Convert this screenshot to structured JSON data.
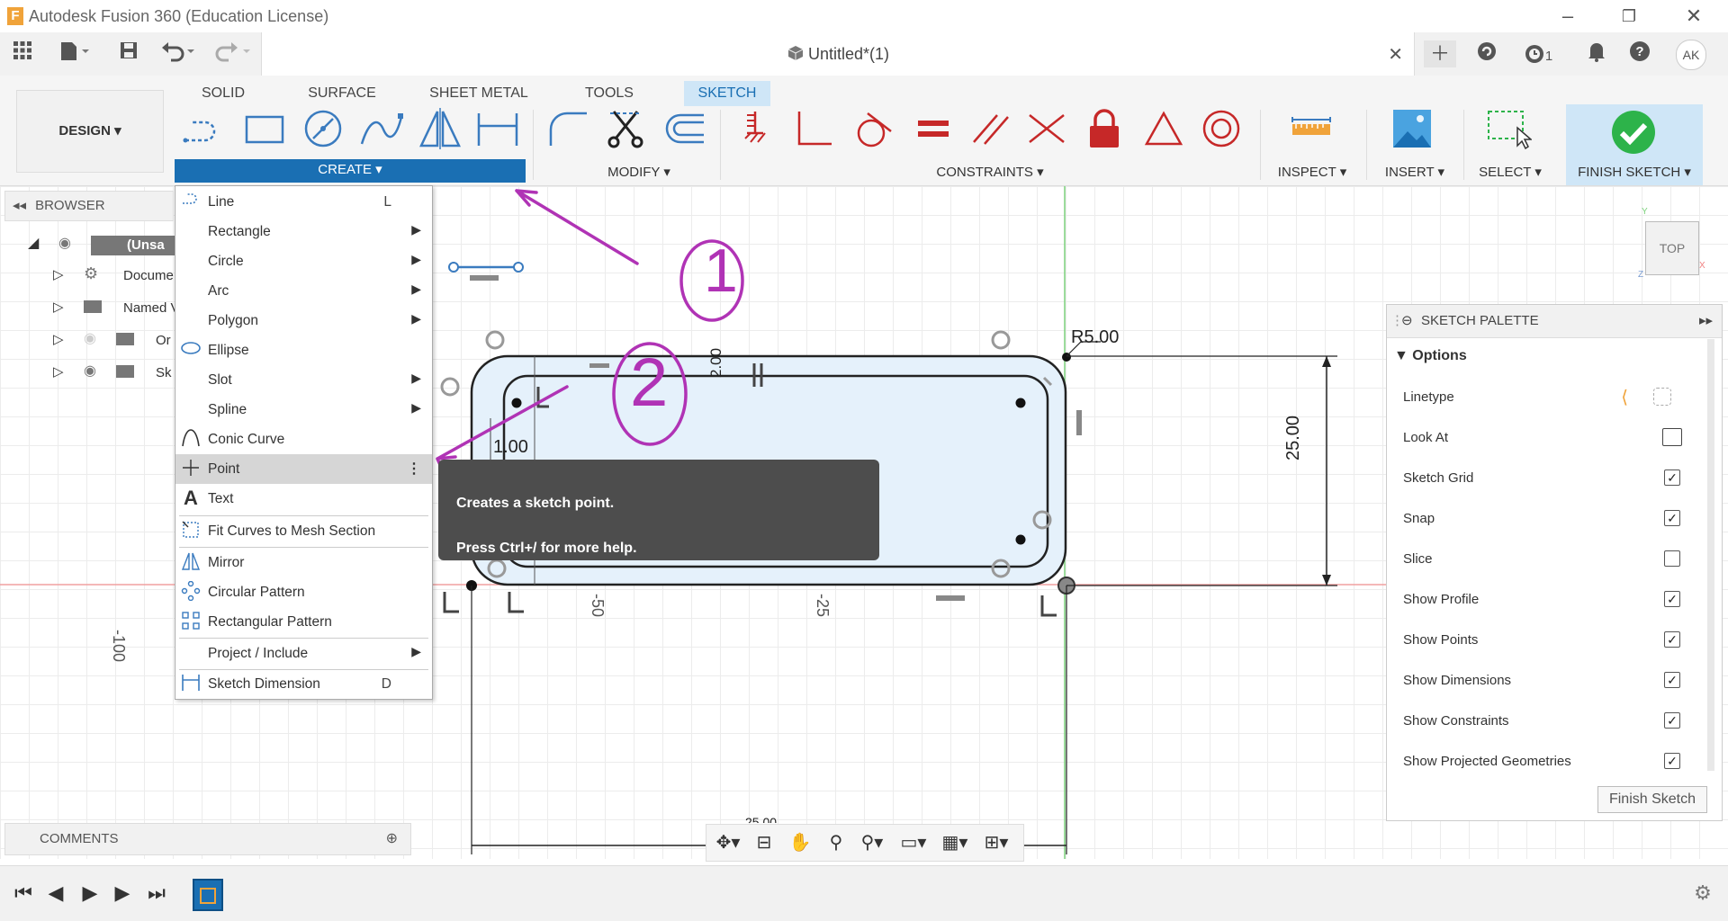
{
  "window": {
    "title": "Autodesk Fusion 360 (Education License)",
    "app_icon": "F",
    "controls": {
      "minimize": "–",
      "restore": "❐",
      "close": "✕"
    }
  },
  "quick_access": {
    "document_title": "Untitled*(1)",
    "job_count": "1",
    "user_initials": "AK"
  },
  "ribbon": {
    "tabs": [
      "SOLID",
      "SURFACE",
      "SHEET METAL",
      "TOOLS",
      "SKETCH"
    ],
    "active_tab": "SKETCH",
    "workspace": "DESIGN ▾",
    "groups": {
      "create": "CREATE ▾",
      "modify": "MODIFY ▾",
      "constraints": "CONSTRAINTS ▾",
      "inspect": "INSPECT ▾",
      "insert": "INSERT ▾",
      "select": "SELECT ▾",
      "finish": "FINISH SKETCH ▾"
    }
  },
  "browser": {
    "title": "BROWSER",
    "items": [
      {
        "label": "(Unsa",
        "icon": "component-icon"
      },
      {
        "label": "Docume",
        "icon": "gear-icon"
      },
      {
        "label": "Named V",
        "icon": "folder-icon"
      },
      {
        "label": "Or",
        "icon": "folder-icon"
      },
      {
        "label": "Sk",
        "icon": "folder-icon"
      }
    ]
  },
  "create_menu": {
    "items": [
      {
        "label": "Line",
        "shortcut": "L",
        "icon": "line-icon"
      },
      {
        "label": "Rectangle",
        "submenu": true
      },
      {
        "label": "Circle",
        "submenu": true
      },
      {
        "label": "Arc",
        "submenu": true
      },
      {
        "label": "Polygon",
        "submenu": true
      },
      {
        "label": "Ellipse",
        "icon": "ellipse-icon"
      },
      {
        "label": "Slot",
        "submenu": true
      },
      {
        "label": "Spline",
        "submenu": true
      },
      {
        "label": "Conic Curve",
        "icon": "conic-curve-icon"
      },
      {
        "label": "Point",
        "icon": "point-icon",
        "highlighted": true
      },
      {
        "label": "Text",
        "icon": "text-icon"
      },
      {
        "label": "Fit Curves to Mesh Section",
        "icon": "fit-curves-icon"
      },
      {
        "label": "Mirror",
        "icon": "mirror-icon"
      },
      {
        "label": "Circular Pattern",
        "icon": "circular-pattern-icon"
      },
      {
        "label": "Rectangular Pattern",
        "icon": "rectangular-pattern-icon"
      },
      {
        "label": "Project / Include",
        "submenu": true
      },
      {
        "label": "Sketch Dimension",
        "shortcut": "D",
        "icon": "sketch-dimension-icon"
      }
    ]
  },
  "tooltip": {
    "line1": "Creates a sketch point.",
    "line2": "Press Ctrl+/ for more help."
  },
  "annotations": {
    "one": "1",
    "two": "2"
  },
  "canvas": {
    "dimensions": {
      "radius": "R5.00",
      "height": "25.00",
      "top_small": "2.00",
      "left_small": "1.00",
      "bottom_partial": "25.00"
    },
    "axis_labels": {
      "minus100": "-100",
      "minus50": "-50",
      "minus25": "-25"
    }
  },
  "viewcube": {
    "face": "TOP",
    "x": "X",
    "y": "Y",
    "z": "Z"
  },
  "sketch_palette": {
    "title": "SKETCH PALETTE",
    "section": "Options",
    "rows": [
      {
        "label": "Linetype",
        "type": "icons"
      },
      {
        "label": "Look At",
        "type": "icon"
      },
      {
        "label": "Sketch Grid",
        "checked": true
      },
      {
        "label": "Snap",
        "checked": true
      },
      {
        "label": "Slice",
        "checked": false
      },
      {
        "label": "Show Profile",
        "checked": true
      },
      {
        "label": "Show Points",
        "checked": true
      },
      {
        "label": "Show Dimensions",
        "checked": true
      },
      {
        "label": "Show Constraints",
        "checked": true
      },
      {
        "label": "Show Projected Geometries",
        "checked": true
      }
    ],
    "finish_button": "Finish Sketch"
  },
  "comments": {
    "title": "COMMENTS"
  },
  "colors": {
    "accent": "#1a6fb3",
    "annotation": "#b033b5",
    "finish_green": "#2db34a",
    "tooltip_bg": "#4d4d4d"
  }
}
